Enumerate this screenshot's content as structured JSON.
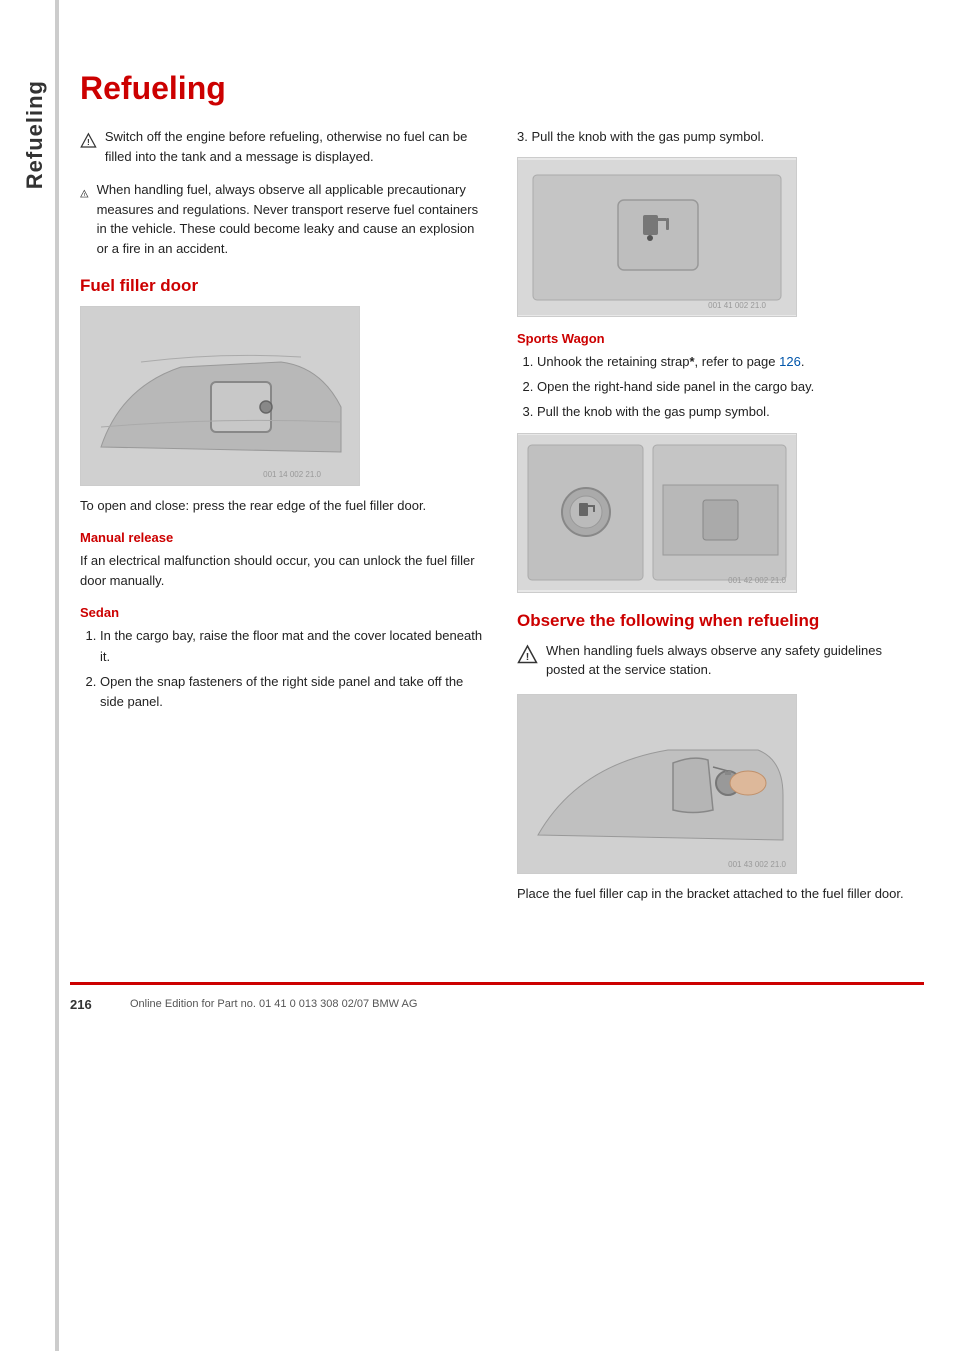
{
  "sidebar": {
    "label": "Refueling"
  },
  "page": {
    "title": "Refueling",
    "warning1": {
      "text": "Switch off the engine before refueling, otherwise no fuel can be filled into the tank and a message is displayed."
    },
    "warning2": {
      "text": "When handling fuel, always observe all applicable precautionary measures and regulations. Never transport reserve fuel containers in the vehicle. These could become leaky and cause an explosion or a fire in an accident."
    },
    "sections": {
      "fuel_filler_door": {
        "heading": "Fuel filler door",
        "caption": "To open and close: press the rear edge of the fuel filler door.",
        "manual_release": {
          "heading": "Manual release",
          "text": "If an electrical malfunction should occur, you can unlock the fuel filler door manually."
        },
        "sedan": {
          "heading": "Sedan",
          "steps": [
            "In the cargo bay, raise the floor mat and the cover located beneath it.",
            "Open the snap fasteners of the right side panel and take off the side panel."
          ]
        }
      },
      "right_col": {
        "step3_label": "3.",
        "step3_text": "Pull the knob with the gas pump symbol.",
        "sports_wagon": {
          "heading": "Sports Wagon",
          "steps": [
            {
              "text": "Unhook the retaining strap",
              "bold_suffix": "*",
              "suffix": ", refer to page ",
              "link": "126",
              "after": "."
            },
            {
              "text": "Open the right-hand side panel in the cargo bay."
            },
            {
              "text": "Pull the knob with the gas pump symbol."
            }
          ]
        },
        "observe_heading": "Observe the following when refueling",
        "observe_warning": {
          "text": "When handling fuels always observe any safety guidelines posted at the service station."
        },
        "observe_caption": "Place the fuel filler cap in the bracket attached to the fuel filler door."
      }
    },
    "footer": {
      "page_number": "216",
      "text": "Online Edition for Part no. 01 41 0 013 308 02/07 BMW AG"
    }
  }
}
